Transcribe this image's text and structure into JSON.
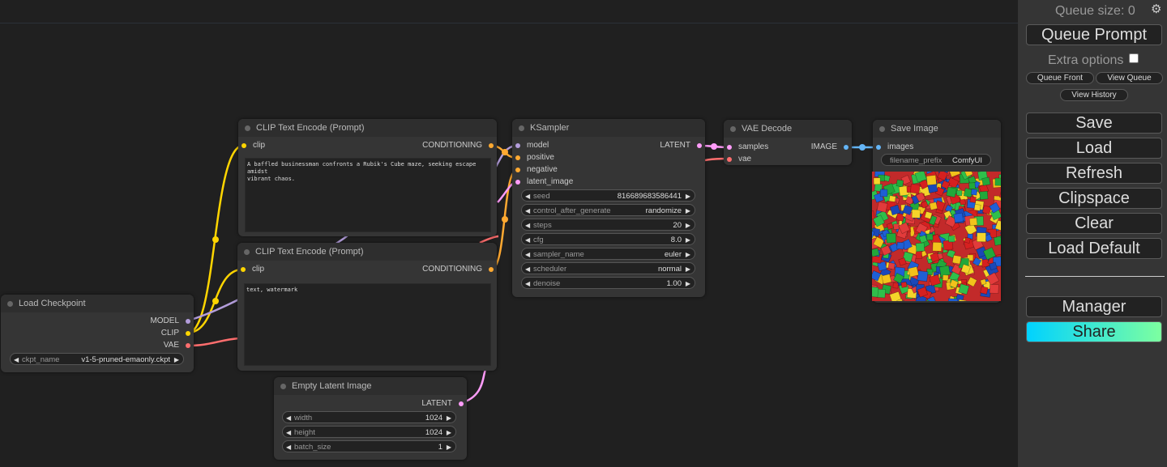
{
  "menu": {
    "queue_size": "Queue size: 0",
    "queue_prompt": "Queue Prompt",
    "extra_options": "Extra options",
    "queue_front": "Queue Front",
    "view_queue": "View Queue",
    "view_history": "View History",
    "save": "Save",
    "load": "Load",
    "refresh": "Refresh",
    "clipspace": "Clipspace",
    "clear": "Clear",
    "load_default": "Load Default",
    "manager": "Manager",
    "share": "Share",
    "settings_icon": "gear-icon"
  },
  "nodes": {
    "clip_pos": {
      "title": "CLIP Text Encode (Prompt)",
      "input_clip": "clip",
      "output": "CONDITIONING",
      "text": "A baffled businessman confronts a Rubik's Cube maze, seeking escape amidst\nvibrant chaos."
    },
    "clip_neg": {
      "title": "CLIP Text Encode (Prompt)",
      "input_clip": "clip",
      "output": "CONDITIONING",
      "text": "text, watermark"
    },
    "ksampler": {
      "title": "KSampler",
      "inputs": [
        "model",
        "positive",
        "negative",
        "latent_image"
      ],
      "output": "LATENT",
      "widgets": [
        {
          "label": "seed",
          "value": "816689683586441"
        },
        {
          "label": "control_after_generate",
          "value": "randomize"
        },
        {
          "label": "steps",
          "value": "20"
        },
        {
          "label": "cfg",
          "value": "8.0"
        },
        {
          "label": "sampler_name",
          "value": "euler"
        },
        {
          "label": "scheduler",
          "value": "normal"
        },
        {
          "label": "denoise",
          "value": "1.00"
        }
      ]
    },
    "vae_decode": {
      "title": "VAE Decode",
      "inputs": [
        "samples",
        "vae"
      ],
      "output": "IMAGE"
    },
    "save_image": {
      "title": "Save Image",
      "input": "images",
      "widget_label": "filename_prefix",
      "widget_value": "ComfyUI"
    },
    "load_checkpoint": {
      "title": "Load Checkpoint",
      "outputs": [
        "MODEL",
        "CLIP",
        "VAE"
      ],
      "widget_label": "ckpt_name",
      "widget_value": "v1-5-pruned-emaonly.ckpt"
    },
    "empty_latent": {
      "title": "Empty Latent Image",
      "output": "LATENT",
      "widgets": [
        {
          "label": "width",
          "value": "1024"
        },
        {
          "label": "height",
          "value": "1024"
        },
        {
          "label": "batch_size",
          "value": "1"
        }
      ]
    }
  },
  "colors": {
    "clip": "#ffd500",
    "conditioning": "#ffa931",
    "model": "#b39ddb",
    "vae": "#ff6e6e",
    "latent": "#ff9cf9",
    "image": "#64b5f6"
  }
}
